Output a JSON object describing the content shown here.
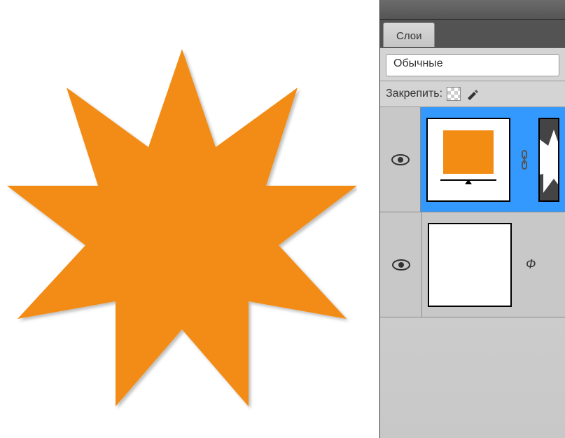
{
  "colors": {
    "shape_fill": "#f28c13",
    "selection": "#3399ff"
  },
  "panel": {
    "tab_label": "Слои",
    "blend_mode": "Обычные",
    "lock_label": "Закрепить:"
  },
  "layers": [
    {
      "visible": true,
      "selected": true,
      "type": "fill",
      "has_mask": true
    },
    {
      "visible": true,
      "selected": false,
      "type": "background",
      "label_partial": "Ф"
    }
  ]
}
